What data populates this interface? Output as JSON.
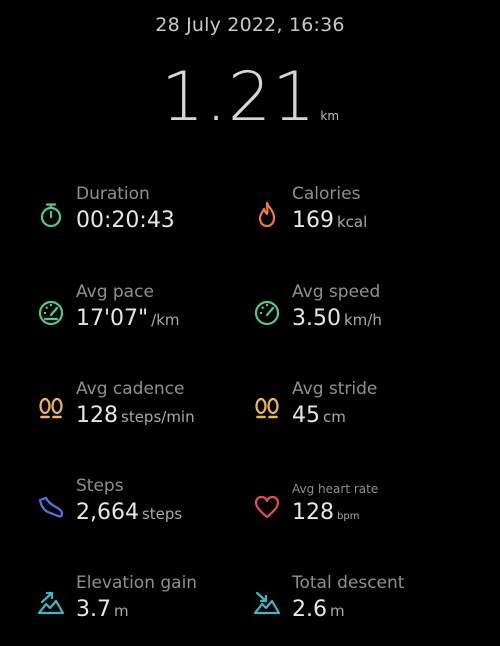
{
  "header": {
    "datetime": "28 July 2022, 16:36"
  },
  "distance": {
    "value": "1.21",
    "unit": "km"
  },
  "colors": {
    "green": "#52c98a",
    "orange": "#ee7a45",
    "yellow": "#f0b45a",
    "blue": "#4d79e8",
    "red": "#e84d4d",
    "teal": "#3fb6c8"
  },
  "stats": [
    {
      "label": "Duration",
      "value": "00:20:43",
      "unit": "",
      "icon": "stopwatch-icon"
    },
    {
      "label": "Calories",
      "value": "169",
      "unit": "kcal",
      "icon": "flame-icon"
    },
    {
      "label": "Avg pace",
      "value": "17'07\"",
      "unit": "/km",
      "icon": "speedometer-icon"
    },
    {
      "label": "Avg speed",
      "value": "3.50",
      "unit": "km/h",
      "icon": "speedometer-icon"
    },
    {
      "label": "Avg cadence",
      "value": "128",
      "unit": "steps/min",
      "icon": "footprints-icon"
    },
    {
      "label": "Avg stride",
      "value": "45",
      "unit": "cm",
      "icon": "footprints-icon"
    },
    {
      "label": "Steps",
      "value": "2,664",
      "unit": "steps",
      "icon": "shoe-icon"
    },
    {
      "label": "Avg heart rate",
      "value": "128",
      "unit": "bpm",
      "icon": "heart-icon"
    },
    {
      "label": "Elevation gain",
      "value": "3.7",
      "unit": "m",
      "icon": "elevation-up-icon"
    },
    {
      "label": "Total descent",
      "value": "2.6",
      "unit": "m",
      "icon": "elevation-down-icon"
    }
  ]
}
